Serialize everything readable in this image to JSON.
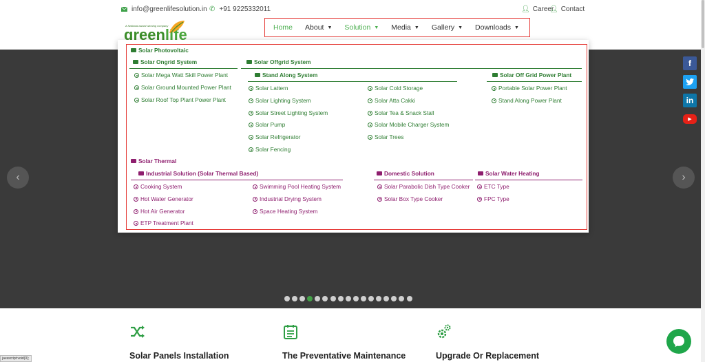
{
  "topbar": {
    "email": "info@greenlifesolution.in",
    "phone": "+91 9225332011",
    "career": "Career",
    "contact": "Contact"
  },
  "logo": {
    "tagline": "A National award winning company",
    "word_a": "green",
    "word_b": "life"
  },
  "nav": {
    "items": [
      {
        "label": "Home",
        "active": true
      },
      {
        "label": "About"
      },
      {
        "label": "Solution",
        "active": true
      },
      {
        "label": "Media"
      },
      {
        "label": "Gallery"
      },
      {
        "label": "Downloads"
      }
    ]
  },
  "menu": {
    "pv_title": "Solar Photovoltaic",
    "ongrid": {
      "title": "Solar Ongrid System",
      "items": [
        "Solar Mega Watt Skill Power Plant",
        "Solar Ground Mounted Power Plant",
        "Solar Roof Top Plant Power Plant"
      ]
    },
    "offgrid": {
      "title": "Solar Offgrid System",
      "standalong_title": "Stand Along System",
      "col1": [
        "Solar Lattern",
        "Solar Lighting System",
        "Solar Street Lighting System",
        "Solar Pump",
        "Solar Refrigerator",
        "Solar Fencing"
      ],
      "col2": [
        "Solar Cold Storage",
        "Solar Atta Cakki",
        "Solar Tea & Snack Stall",
        "Solar Mobile Charger System",
        "Solar Trees"
      ],
      "offgrid_power_title": "Solar Off Grid Power Plant",
      "col3": [
        "Portable Solar Power Plant",
        "Stand Along Power Plant"
      ]
    },
    "thermal": {
      "title": "Solar Thermal",
      "industrial_title": "Industrial Solution (Solar Thermal Based)",
      "ind_col1": [
        "Cooking System",
        "Hot Water Generator",
        "Hot Air Generator",
        "ETP Treatment Plant"
      ],
      "ind_col2": [
        "Swimming Pool Heating System",
        "Industrial Drying System",
        "Space Heating System"
      ],
      "domestic_title": "Domestic Solution",
      "domestic": [
        "Solar Parabolic Dish Type Cooker",
        "Solar Box Type Cooker"
      ],
      "water_title": "Solar Water Heating",
      "water": [
        "ETC Type",
        "FPC Type"
      ]
    }
  },
  "slider": {
    "dot_count": 17,
    "active_dot": 4
  },
  "social": {
    "facebook": "f",
    "twitter": "t",
    "linkedin": "in",
    "youtube": "▶"
  },
  "features": [
    {
      "icon": "shuffle-icon",
      "title": "Solar Panels Installation"
    },
    {
      "icon": "calendar-list-icon",
      "title": "The Preventative Maintenance"
    },
    {
      "icon": "gears-icon",
      "title": "Upgrade Or Replacement"
    }
  ],
  "statusbar": "javascript:void(0);",
  "colors": {
    "green": "#2e7d32",
    "purple": "#8e1e6e",
    "accent": "#4caf50"
  }
}
